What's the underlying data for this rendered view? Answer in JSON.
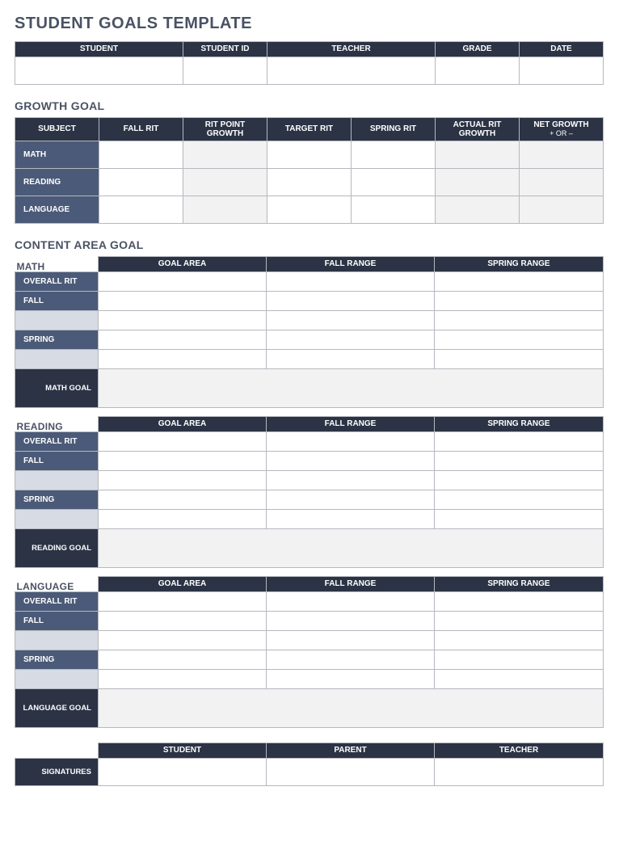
{
  "title": "STUDENT GOALS TEMPLATE",
  "info": {
    "headers": [
      "STUDENT",
      "STUDENT ID",
      "TEACHER",
      "GRADE",
      "DATE"
    ],
    "values": [
      "",
      "",
      "",
      "",
      ""
    ]
  },
  "growth": {
    "title": "GROWTH GOAL",
    "headers": {
      "subject": "SUBJECT",
      "fall_rit": "FALL RIT",
      "rit_point_growth": "RIT POINT GROWTH",
      "target_rit": "TARGET RIT",
      "spring_rit": "SPRING RIT",
      "actual_rit_growth": "ACTUAL RIT GROWTH",
      "net_growth": "NET GROWTH",
      "net_growth_sub": "+ OR –"
    },
    "rows": [
      {
        "label": "MATH",
        "fall_rit": "",
        "rit_point_growth": "",
        "target_rit": "",
        "spring_rit": "",
        "actual_rit_growth": "",
        "net_growth": ""
      },
      {
        "label": "READING",
        "fall_rit": "",
        "rit_point_growth": "",
        "target_rit": "",
        "spring_rit": "",
        "actual_rit_growth": "",
        "net_growth": ""
      },
      {
        "label": "LANGUAGE",
        "fall_rit": "",
        "rit_point_growth": "",
        "target_rit": "",
        "spring_rit": "",
        "actual_rit_growth": "",
        "net_growth": ""
      }
    ]
  },
  "content": {
    "title": "CONTENT AREA GOAL",
    "col_headers": [
      "GOAL AREA",
      "FALL RANGE",
      "SPRING RANGE"
    ],
    "side_labels": {
      "overall_rit": "OVERALL RIT",
      "fall": "FALL",
      "spring": "SPRING"
    },
    "subjects": [
      {
        "name": "MATH",
        "goal_label": "MATH GOAL",
        "overall_rit": "",
        "fall1": [
          "",
          "",
          ""
        ],
        "fall2": [
          "",
          "",
          ""
        ],
        "spring1": [
          "",
          "",
          ""
        ],
        "spring2": [
          "",
          "",
          ""
        ],
        "goal": ""
      },
      {
        "name": "READING",
        "goal_label": "READING GOAL",
        "overall_rit": "",
        "fall1": [
          "",
          "",
          ""
        ],
        "fall2": [
          "",
          "",
          ""
        ],
        "spring1": [
          "",
          "",
          ""
        ],
        "spring2": [
          "",
          "",
          ""
        ],
        "goal": ""
      },
      {
        "name": "LANGUAGE",
        "goal_label": "LANGUAGE GOAL",
        "overall_rit": "",
        "fall1": [
          "",
          "",
          ""
        ],
        "fall2": [
          "",
          "",
          ""
        ],
        "spring1": [
          "",
          "",
          ""
        ],
        "spring2": [
          "",
          "",
          ""
        ],
        "goal": ""
      }
    ]
  },
  "signatures": {
    "label": "SIGNATURES",
    "headers": [
      "STUDENT",
      "PARENT",
      "TEACHER"
    ],
    "values": [
      "",
      "",
      ""
    ]
  }
}
